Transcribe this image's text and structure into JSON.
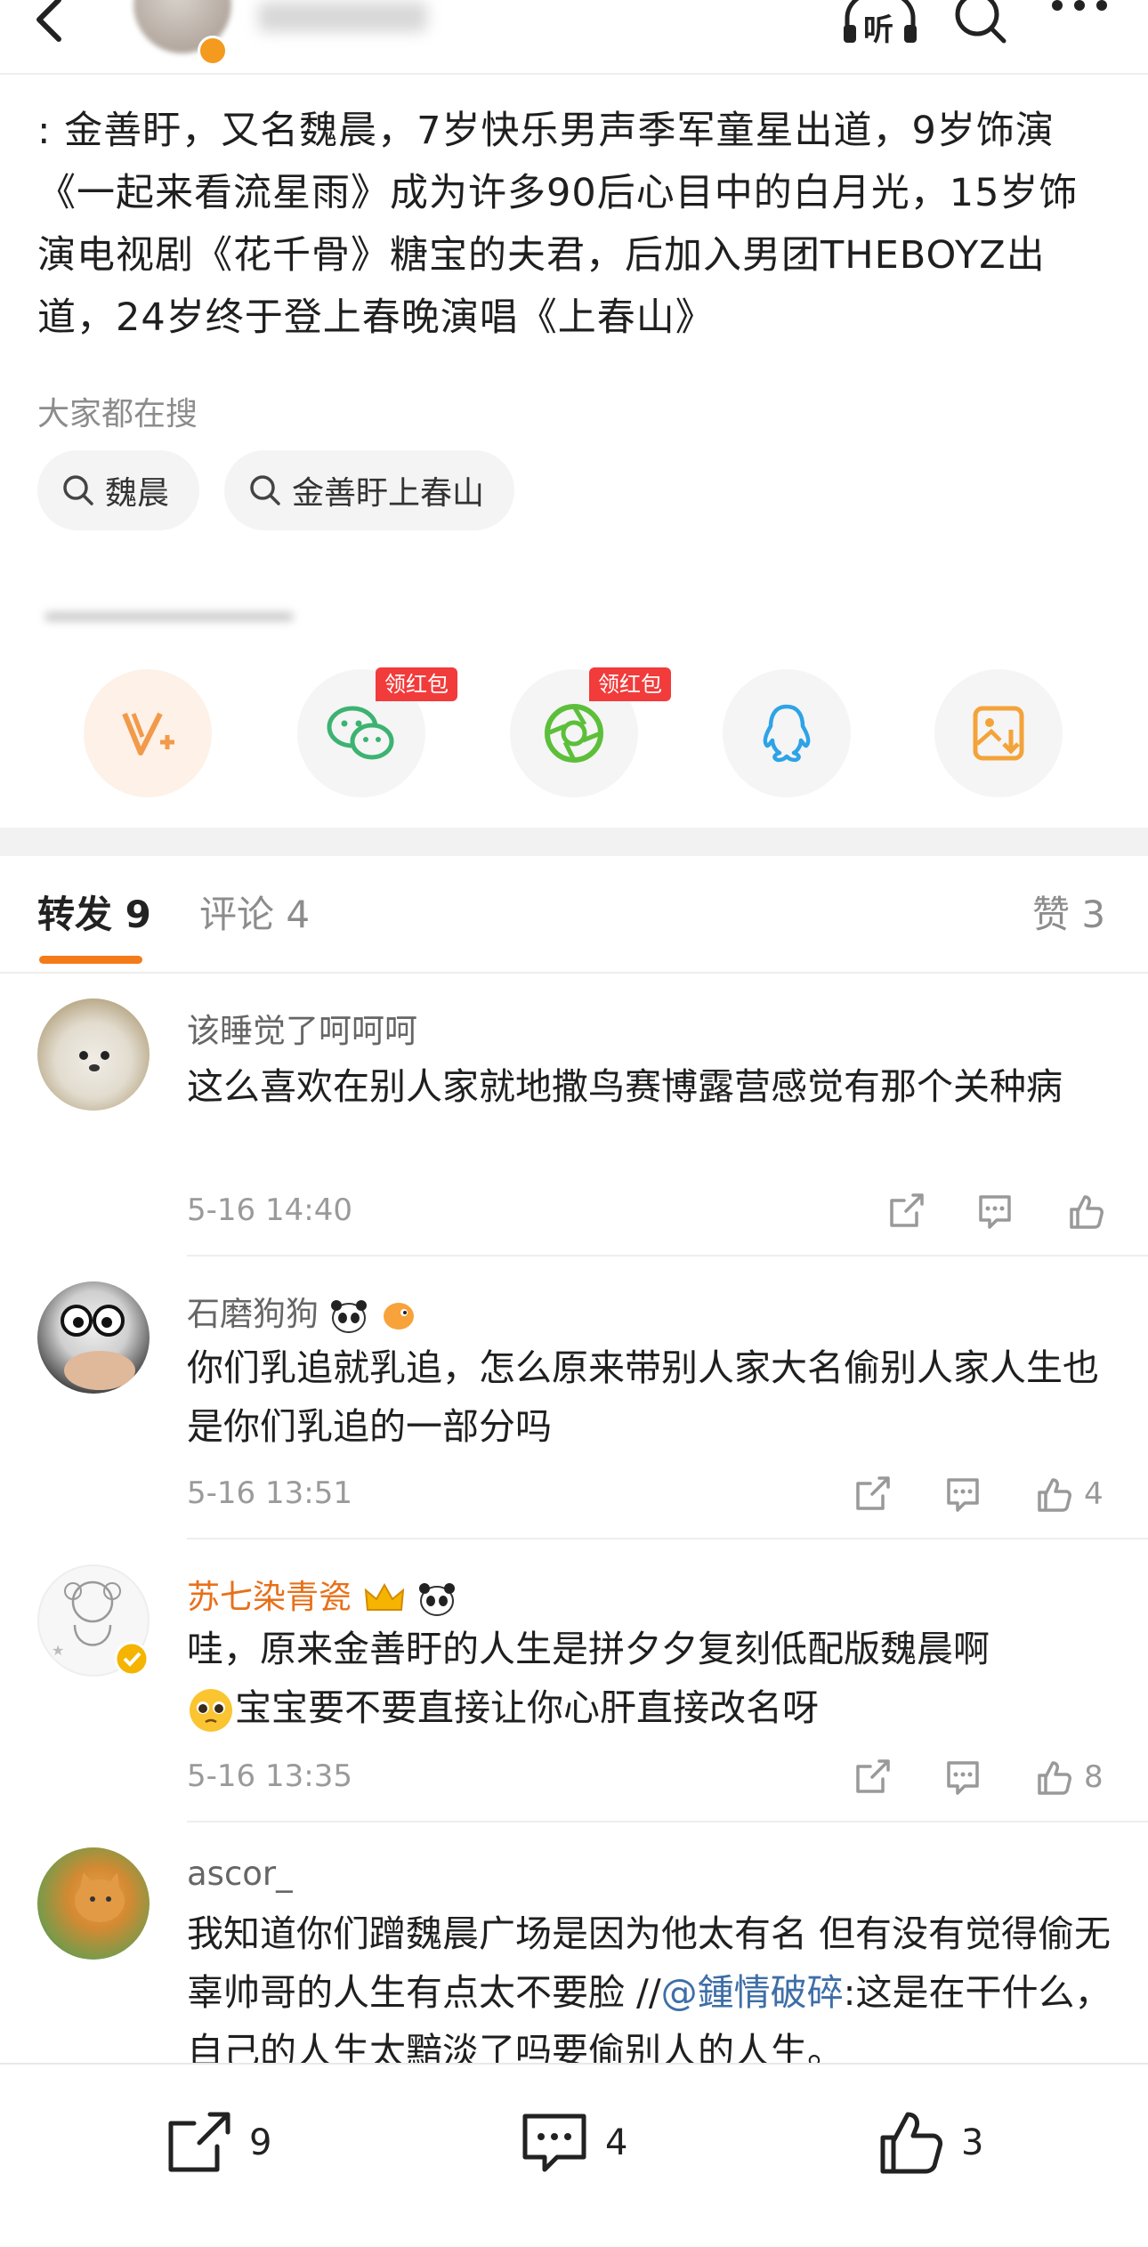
{
  "header": {
    "listen_label": "听"
  },
  "post": {
    "text": ": 金善盱，又名魏晨，7岁快乐男声季军童星出道，9岁饰演《一起来看流星雨》成为许多90后心目中的白月光，15岁饰演电视剧《花千骨》糖宝的夫君，后加入男团THEBOYZ出道，24岁终于登上春晚演唱《上春山》"
  },
  "search": {
    "title": "大家都在搜",
    "chips": [
      "魏晨",
      "金善盱上春山"
    ]
  },
  "share": {
    "tag_label": "领红包",
    "items": [
      "v-plus",
      "wechat",
      "moments",
      "qq",
      "save-image"
    ]
  },
  "tabs": {
    "repost": "转发 9",
    "comment": "评论 4",
    "like": "赞 3"
  },
  "comments": [
    {
      "name": "该睡觉了呵呵呵",
      "text": "这么喜欢在别人家就地撒鸟赛博露营感觉有那个关种病",
      "time": "5-16 14:40",
      "like_count": ""
    },
    {
      "name": "石磨狗狗",
      "text": "你们乳追就乳追，怎么原来带别人家大名偷别人家人生也是你们乳追的一部分吗",
      "time": "5-16 13:51",
      "like_count": "4"
    },
    {
      "name": "苏七染青瓷",
      "text_line1": "哇，原来金善盱的人生是拼夕夕复刻低配版魏晨啊",
      "text_line2": "宝宝要不要直接让你心肝直接改名呀",
      "time": "5-16 13:35",
      "like_count": "8"
    },
    {
      "name": "ascor_",
      "text_before": "我知道你们蹭魏晨广场是因为他太有名 但有没有觉得偷无辜帅哥的人生有点太不要脸 //",
      "mention": "@鍾情破碎",
      "text_after": ":这是在干什么，自己的人生太黯淡了吗要偷别人的人生。"
    }
  ],
  "bottom": {
    "repost_count": "9",
    "comment_count": "4",
    "like_count": "3"
  },
  "colors": {
    "accent": "#f47b1a",
    "mention": "#3e6ea7",
    "tag": "#f23b3b"
  }
}
